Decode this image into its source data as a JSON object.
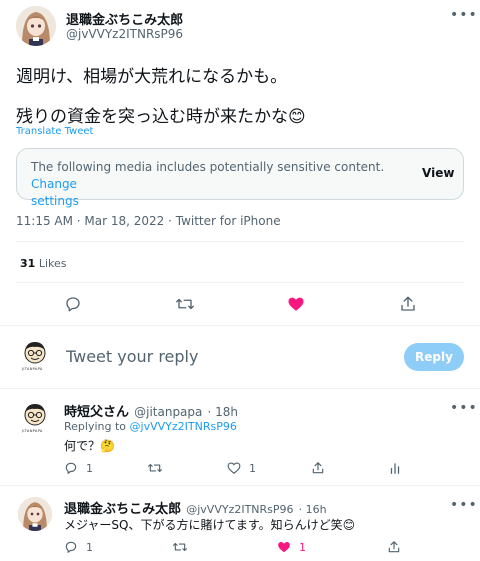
{
  "tweet": {
    "author_name": "退職金ぶちこみ太郎",
    "author_handle": "@jvVVYz2ITNRsP96",
    "text_line1": "週明け、相場が大荒れになるかも。",
    "text_line2": "残りの資金を突っ込む時が来たかな😊",
    "translate_label": "Translate Tweet",
    "sensitive_notice": "The following media includes potentially sensitive content.",
    "change_settings_link": "Change",
    "change_settings_link2": "settings",
    "view_button": "View",
    "timestamp": "11:15 AM · Mar 18, 2022 · Twitter for iPhone",
    "likes_count": "31",
    "likes_label": "Likes"
  },
  "reply_box": {
    "placeholder": "Tweet your reply",
    "reply_button": "Reply",
    "avatar_caption": "JITANPAPA"
  },
  "replies": [
    {
      "author_name": "時短父さん",
      "author_handle": "@jitanpapa",
      "time": "· 18h",
      "replying_to_label": "Replying to",
      "replying_to_handle": "@jvVVYz2ITNRsP96",
      "text": "何で？🤔",
      "reply_count": "1",
      "like_count": "1",
      "avatar_caption": "JITANPAPA"
    },
    {
      "author_name": "退職金ぶちこみ太郎",
      "author_handle": "@jvVVYz2ITNRsP96",
      "time": "· 16h",
      "text": "メジャーSQ、下がる方に賭けてます。知らんけど笑😊",
      "reply_count": "1",
      "like_count": "1"
    }
  ],
  "colors": {
    "accent": "#1d9bf0",
    "like": "#f91880",
    "reply_button_bg": "#8ecdf8",
    "text_secondary": "#536471"
  }
}
